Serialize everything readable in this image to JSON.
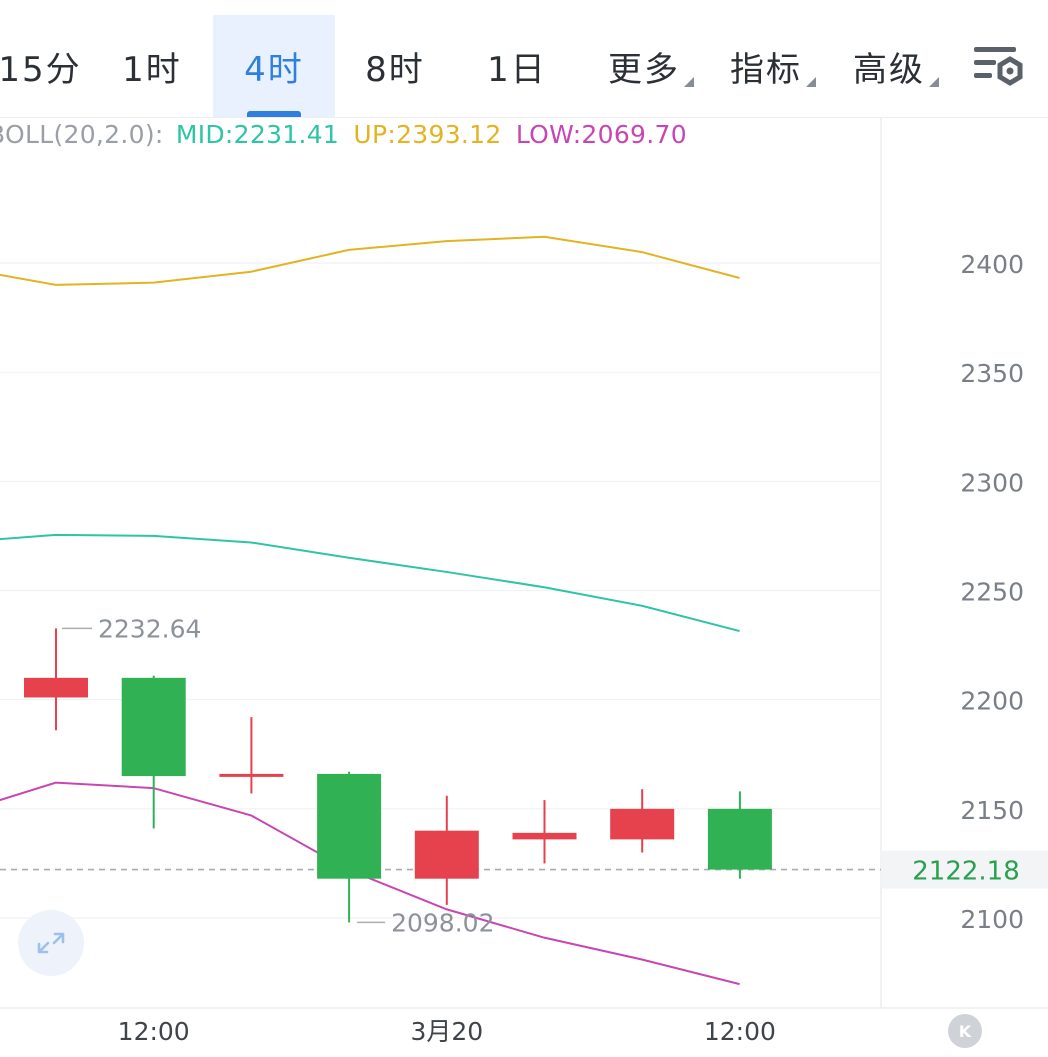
{
  "tabs": [
    {
      "label": "15分",
      "active": false
    },
    {
      "label": "1时",
      "active": false
    },
    {
      "label": "4时",
      "active": true
    },
    {
      "label": "8时",
      "active": false
    },
    {
      "label": "1日",
      "active": false
    },
    {
      "label": "更多",
      "active": false,
      "dropdown": true
    },
    {
      "label": "指标",
      "active": false,
      "dropdown": true
    },
    {
      "label": "高级",
      "active": false,
      "dropdown": true
    }
  ],
  "icons": {
    "settings": "chart-settings-icon",
    "expand": "expand-icon",
    "k": "k-line-icon"
  },
  "k_button_label": "K",
  "legend": {
    "label": "BOLL(20,2.0):",
    "mid": "MID:2231.41",
    "up": "UP:2393.12",
    "low": "LOW:2069.70"
  },
  "colors": {
    "accent": "#2f7fe0",
    "up_candle": "#e5424e",
    "down_candle": "#30b254",
    "mid": "#2ec4a6",
    "upper": "#e3b321",
    "lower": "#c846b4",
    "price": "#2aa150"
  },
  "chart_data": {
    "type": "candlestick",
    "y_ticks": [
      2100,
      2150,
      2200,
      2250,
      2300,
      2350,
      2400
    ],
    "x_tick_labels": [
      "12:00",
      "3月20",
      "12:00"
    ],
    "ylim": [
      2060,
      2460
    ],
    "grid": true,
    "current_price": 2122.18,
    "current_price_label": "2122.18",
    "high_marker_label": "2232.64",
    "low_marker_label": "2098.02",
    "candles": [
      {
        "open": 2201,
        "close": 2210,
        "high": 2232.64,
        "low": 2186
      },
      {
        "open": 2210,
        "close": 2165,
        "high": 2211,
        "low": 2141
      },
      {
        "open": 2166,
        "close": 2166,
        "high": 2192,
        "low": 2157
      },
      {
        "open": 2166,
        "close": 2118,
        "high": 2167,
        "low": 2098.02
      },
      {
        "open": 2118,
        "close": 2140,
        "high": 2156,
        "low": 2106
      },
      {
        "open": 2136,
        "close": 2139,
        "high": 2154,
        "low": 2125
      },
      {
        "open": 2136,
        "close": 2150,
        "high": 2159,
        "low": 2130
      },
      {
        "open": 2150,
        "close": 2122.18,
        "high": 2158,
        "low": 2118
      }
    ],
    "series": [
      {
        "name": "UP",
        "values": [
          2398,
          2390,
          2391,
          2396,
          2406,
          2410,
          2412,
          2405,
          2393.12
        ],
        "color": "#e3b321"
      },
      {
        "name": "MID",
        "values": [
          2272,
          2275.5,
          2275,
          2272,
          2265,
          2258.5,
          2251.5,
          2243,
          2231.41
        ],
        "color": "#2ec4a6"
      },
      {
        "name": "LOW",
        "values": [
          2148,
          2162,
          2159.5,
          2147,
          2122,
          2104,
          2091,
          2081,
          2069.7
        ],
        "color": "#c846b4"
      }
    ]
  }
}
